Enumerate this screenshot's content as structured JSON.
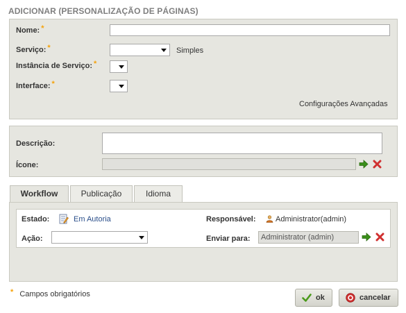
{
  "page": {
    "title": "ADICIONAR (PERSONALIZAÇÃO DE PÁGINAS)"
  },
  "form": {
    "nome_label": "Nome:",
    "servico_label": "Serviço:",
    "servico_hint": "Simples",
    "instancia_label": "Instância de Serviço:",
    "interface_label": "Interface:",
    "required_mark": "*",
    "advanced_link": "Configurações Avançadas",
    "descricao_label": "Descrição:",
    "icone_label": "Ícone:"
  },
  "tabs": [
    {
      "label": "Workflow",
      "active": true
    },
    {
      "label": "Publicação",
      "active": false
    },
    {
      "label": "Idioma",
      "active": false
    }
  ],
  "workflow": {
    "estado_label": "Estado:",
    "estado_value": "Em Autoria",
    "acao_label": "Ação:",
    "responsavel_label": "Responsável:",
    "responsavel_value": "Administrator(admin)",
    "enviar_label": "Enviar para:",
    "enviar_value": "Administrator (admin)"
  },
  "footer": {
    "required_note": "Campos obrigatórios",
    "ok_label": "ok",
    "cancel_label": "cancelar"
  },
  "colors": {
    "panel_bg": "#e6e6e0",
    "required": "#f5a20a",
    "ok_green": "#4a9a1a",
    "cancel_red": "#d03030",
    "arrow_green": "#3a8f1a"
  }
}
